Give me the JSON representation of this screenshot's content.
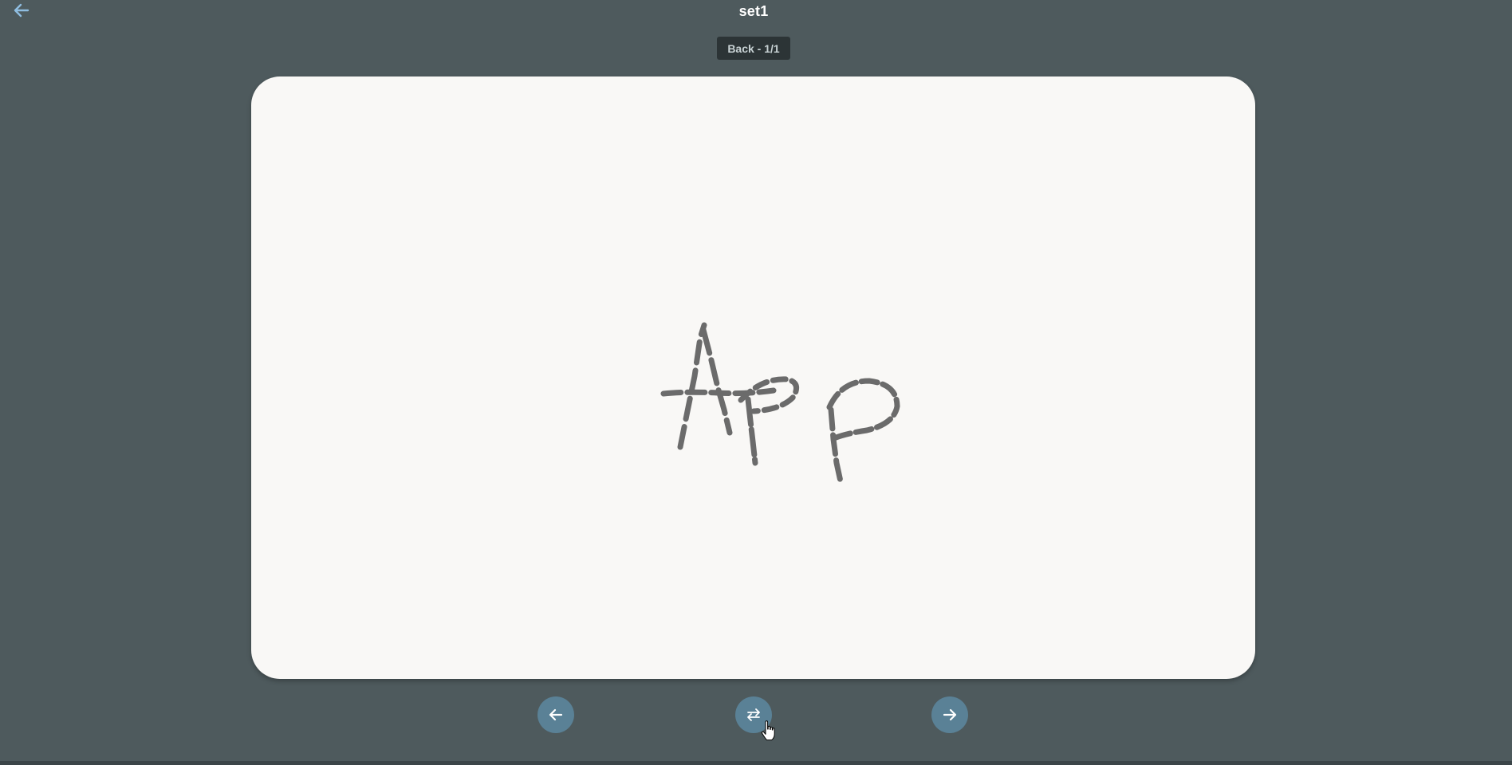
{
  "header": {
    "title": "set1",
    "back_icon": "arrow-left-icon"
  },
  "card": {
    "side_label": "Back - 1/1",
    "content_kind": "handwritten drawing",
    "handwritten_text": "App"
  },
  "controls": {
    "prev_icon": "arrow-left-icon",
    "flip_icon": "swap-arrows-icon",
    "next_icon": "arrow-right-icon"
  },
  "colors": {
    "background": "#4e5a5d",
    "card": "#f9f8f6",
    "badge": "#2c3436",
    "button": "#5a8196",
    "ink": "#6b6b6b",
    "back_arrow": "#8fbde0"
  }
}
